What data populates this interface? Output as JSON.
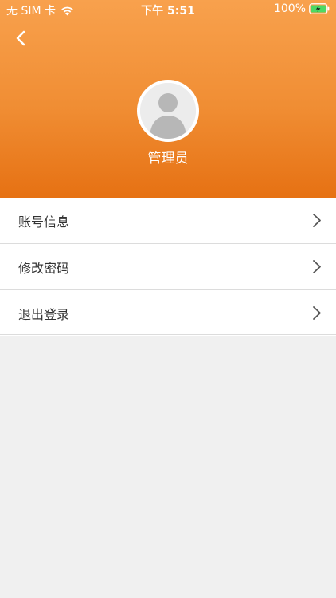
{
  "status_bar": {
    "carrier": "无 SIM 卡",
    "time": "下午 5:51",
    "battery": "100%",
    "icons": {
      "wifi": "wifi-icon",
      "battery": "battery-charging-icon"
    }
  },
  "header": {
    "back_icon": "chevron-left-icon",
    "avatar_icon": "user-avatar-icon",
    "username": "管理员"
  },
  "menu": {
    "items": [
      {
        "label": "账号信息",
        "icon": "chevron-right-icon"
      },
      {
        "label": "修改密码",
        "icon": "chevron-right-icon"
      },
      {
        "label": "退出登录",
        "icon": "chevron-right-icon"
      }
    ]
  },
  "colors": {
    "header_top": "#f8a14d",
    "header_bottom": "#e67113",
    "background": "#f0f0f0",
    "battery_charge": "#4cd964"
  }
}
